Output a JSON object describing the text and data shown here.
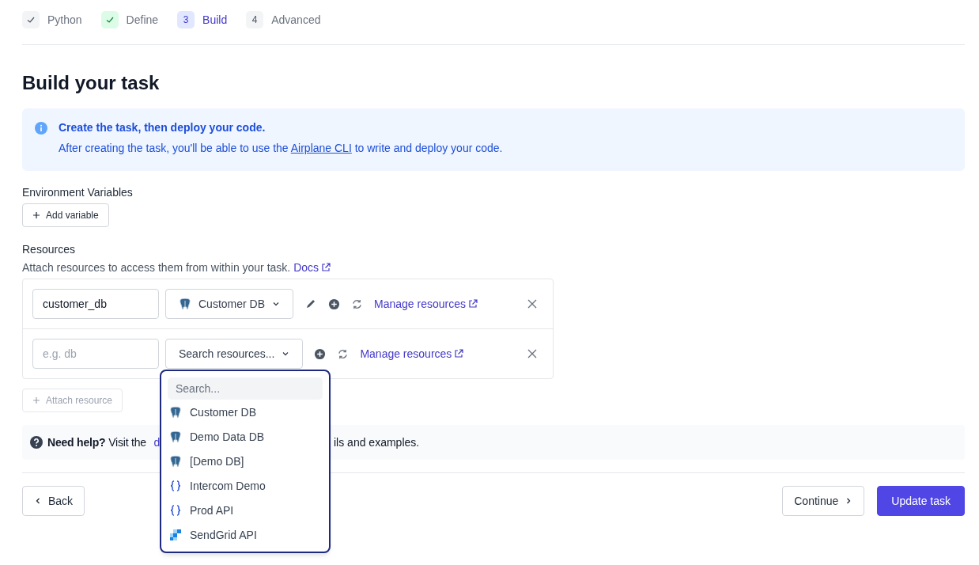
{
  "steps": [
    {
      "label": "Python",
      "kind": "complete"
    },
    {
      "label": "Define",
      "kind": "valid"
    },
    {
      "number": "3",
      "label": "Build",
      "kind": "current"
    },
    {
      "number": "4",
      "label": "Advanced",
      "kind": "upcoming"
    }
  ],
  "title": "Build your task",
  "info": {
    "heading": "Create the task, then deploy your code.",
    "text_before": "After creating the task, you'll be able to use the",
    "link": "Airplane CLI",
    "text_after": "to write and deploy your code."
  },
  "env": {
    "label": "Environment Variables",
    "button": "Add variable"
  },
  "resources": {
    "label": "Resources",
    "description": "Attach resources to access them from within your task.",
    "docs_link": "Docs",
    "rows": [
      {
        "name_value": "customer_db",
        "resource": {
          "label": "Customer DB",
          "kind": "postgres"
        },
        "editable": true,
        "open": false,
        "manage_link": "Manage resources"
      },
      {
        "name_placeholder": "e.g. db",
        "select_placeholder": "Search resources...",
        "editable": false,
        "open": true,
        "manage_link": "Manage resources"
      }
    ],
    "attach_button": {
      "label": "Attach resource",
      "disabled": true
    },
    "dropdown": {
      "search_placeholder": "Search...",
      "options": [
        {
          "label": "Customer DB",
          "kind": "postgres",
          "selected": false
        },
        {
          "label": "Demo Data DB",
          "kind": "postgres",
          "selected": false
        },
        {
          "label": "[Demo DB]",
          "kind": "postgres",
          "selected": false
        },
        {
          "label": "Intercom Demo",
          "kind": "rest",
          "selected": false
        },
        {
          "label": "Prod API",
          "kind": "rest",
          "selected": false
        },
        {
          "label": "SendGrid API",
          "kind": "sendgrid",
          "selected": false
        }
      ]
    }
  },
  "help": {
    "bold": "Need help?",
    "text": "Visit the",
    "link": "d",
    "tail": "ils and examples."
  },
  "footer": {
    "back": "Back",
    "continue": "Continue",
    "submit": "Update task"
  }
}
